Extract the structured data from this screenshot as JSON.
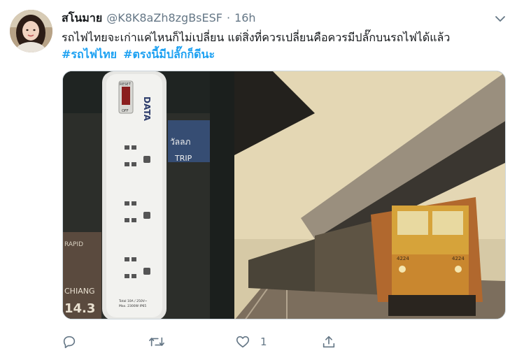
{
  "tweet": {
    "display_name": "สโนมาย",
    "handle": "@K8K8aZh8zgBsESF",
    "separator": "·",
    "timestamp": "16h",
    "text": "รถไฟไทยจะเก่าแค่ไหนก็ไม่เปลี่ยน แต่สิ่งที่ควรเปลี่ยนคือควรมีปลั๊กบนรถไฟได้แล้ว",
    "hashtags": [
      "#รถไฟไทย",
      "#ตรงนี้มีปลั๊กก็ดีนะ"
    ],
    "media": {
      "plug_brand": "DATA",
      "plug_reset": "RESET",
      "plug_switch_off": "OFF",
      "plug_spec": "Total 10A / 250V~",
      "plug_spec2": "Max. 2300W IP65",
      "locomotive_number": "4224",
      "sign_text_1": "วัลลภ",
      "sign_text_2": "TRIP",
      "sign_text_3": "CHIANG",
      "sign_text_4": "14.3",
      "sign_text_5": "RAPID"
    },
    "actions": {
      "reply_count": "",
      "retweet_count": "",
      "like_count": "1",
      "share_count": ""
    }
  },
  "icons": {
    "caret": "chevron-down-icon",
    "reply": "reply-icon",
    "retweet": "retweet-icon",
    "like": "heart-icon",
    "share": "share-icon"
  },
  "colors": {
    "link": "#1da1f2",
    "secondary_text": "#657786",
    "primary_text": "#14171a"
  }
}
